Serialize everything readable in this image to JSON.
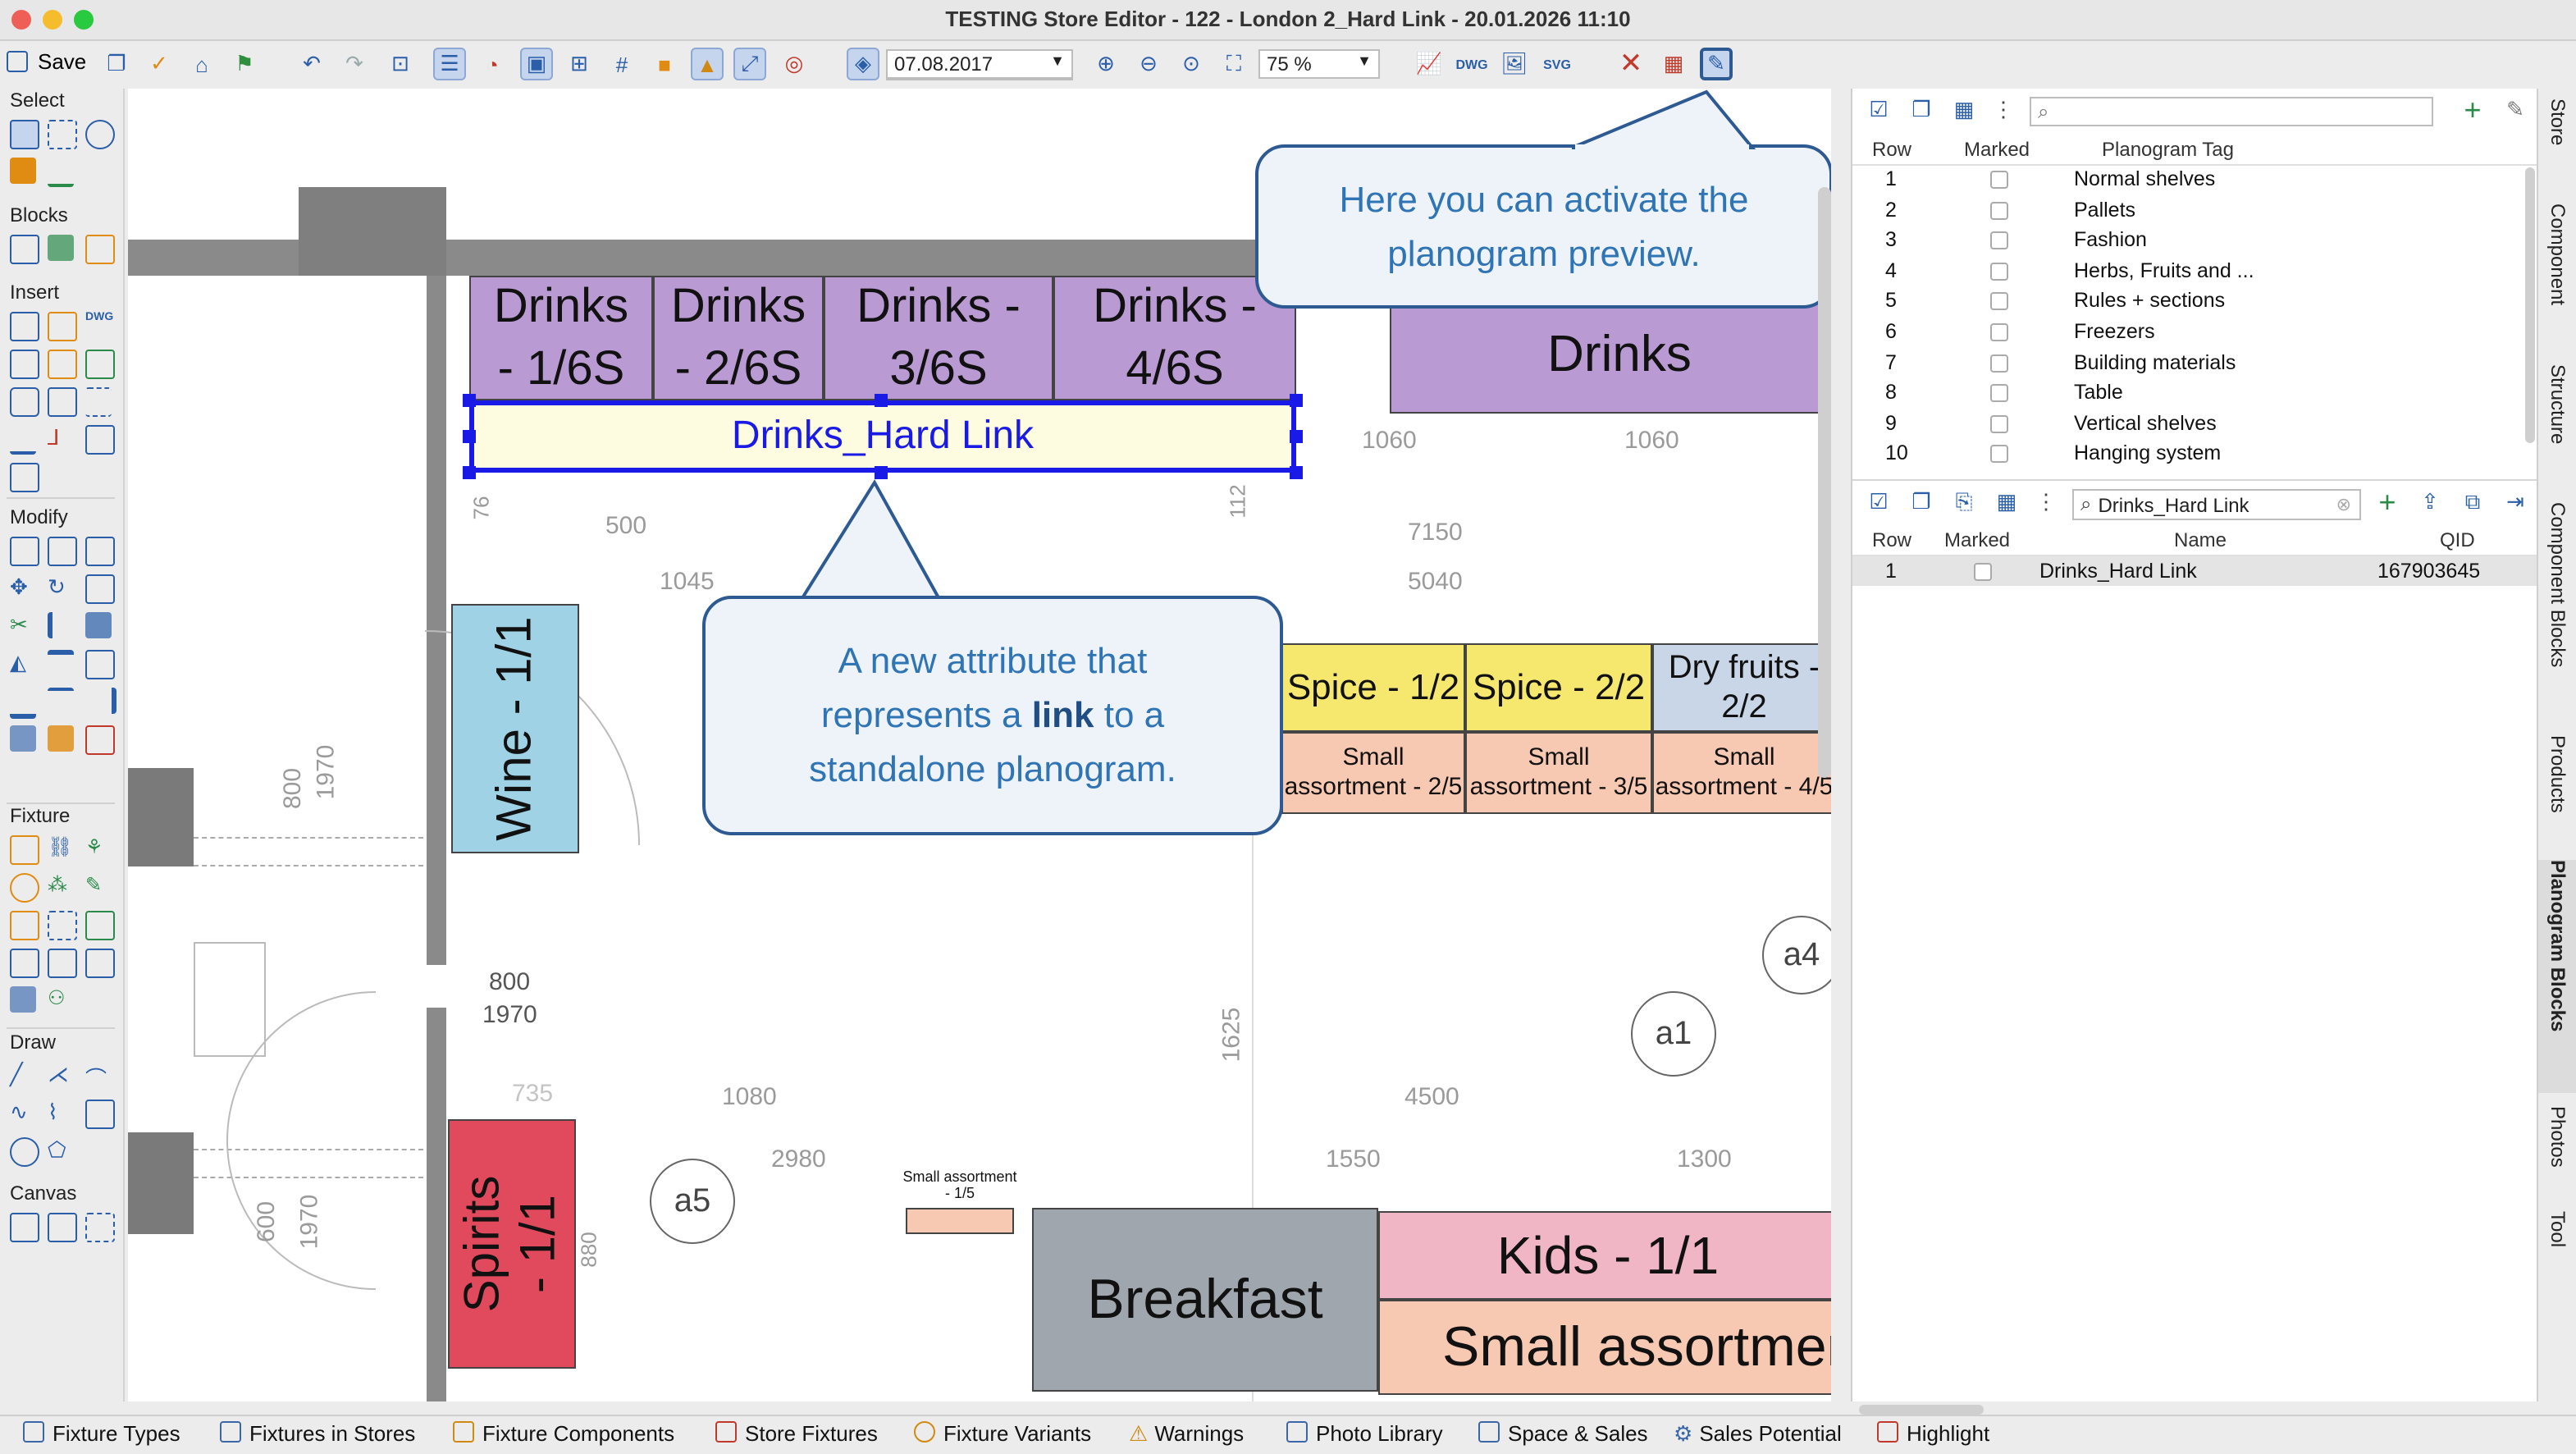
{
  "window": {
    "title": "TESTING Store Editor - 122 - London 2_Hard Link - 20.01.2026 11:10"
  },
  "toolbar": {
    "save_label": "Save",
    "date_value": "07.08.2017",
    "zoom_value": "75 %"
  },
  "palette": {
    "select": "Select",
    "blocks": "Blocks",
    "insert": "Insert",
    "modify": "Modify",
    "fixture": "Fixture",
    "draw": "Draw",
    "canvas": "Canvas"
  },
  "plan": {
    "drinks_blocks": [
      {
        "l1": "Drinks",
        "l2": "- 1/6S"
      },
      {
        "l1": "Drinks",
        "l2": "- 2/6S"
      },
      {
        "l1": "Drinks -",
        "l2": "3/6S"
      },
      {
        "l1": "Drinks -",
        "l2": "4/6S"
      }
    ],
    "drinks_big": "Drinks",
    "hard_link": "Drinks_Hard Link",
    "wine": "Wine - 1/1",
    "spirits": "Spirits - 1/1",
    "spice1": "Spice - 1/2",
    "spice2": "Spice - 2/2",
    "dryfruits": "Dry fruits - 2/2",
    "small1": "Small assortment - 2/5",
    "small2": "Small assortment - 3/5",
    "small3": "Small assortment - 4/5",
    "small_tiny": "Small assortment - 1/5",
    "breakfast": "Breakfast",
    "kids": "Kids - 1/1",
    "small_big": "Small assortmen",
    "markers": [
      "a4",
      "a1",
      "a5"
    ],
    "dims": [
      "1060",
      "1060",
      "500",
      "7150",
      "1045",
      "5040",
      "800",
      "1970",
      "800",
      "1970",
      "600",
      "1970",
      "735",
      "1080",
      "4500",
      "2980",
      "1550",
      "1300",
      "1625",
      "112",
      "76",
      "880"
    ]
  },
  "callout_top": {
    "line1": "Here you can activate the",
    "line2": "planogram preview."
  },
  "callout_mid": {
    "line1": "A new attribute that",
    "line2_pre": "represents a ",
    "line2_bold": "link",
    "line2_post": " to a",
    "line3": "standalone planogram."
  },
  "tag_table": {
    "headers": [
      "Row",
      "Marked",
      "Planogram Tag"
    ],
    "rows": [
      {
        "row": "1",
        "tag": "Normal shelves"
      },
      {
        "row": "2",
        "tag": "Pallets"
      },
      {
        "row": "3",
        "tag": "Fashion"
      },
      {
        "row": "4",
        "tag": "Herbs, Fruits and ..."
      },
      {
        "row": "5",
        "tag": "Rules + sections"
      },
      {
        "row": "6",
        "tag": "Freezers"
      },
      {
        "row": "7",
        "tag": "Building materials"
      },
      {
        "row": "8",
        "tag": "Table"
      },
      {
        "row": "9",
        "tag": "Vertical shelves"
      },
      {
        "row": "10",
        "tag": "Hanging system"
      }
    ]
  },
  "block_search": {
    "value": "Drinks_Hard Link"
  },
  "block_table": {
    "headers": [
      "Row",
      "Marked",
      "Name",
      "QID"
    ],
    "rows": [
      {
        "row": "1",
        "name": "Drinks_Hard Link",
        "qid": "167903645"
      }
    ]
  },
  "side_tabs": [
    "Store",
    "Component",
    "Structure",
    "Component Blocks",
    "Products",
    "Planogram Blocks",
    "Photos",
    "Tool"
  ],
  "bottom_tabs": [
    "Fixture Types",
    "Fixtures in Stores",
    "Fixture Components",
    "Store Fixtures",
    "Fixture Variants",
    "Warnings",
    "Photo Library",
    "Space & Sales",
    "Sales Potential",
    "Highlight"
  ]
}
